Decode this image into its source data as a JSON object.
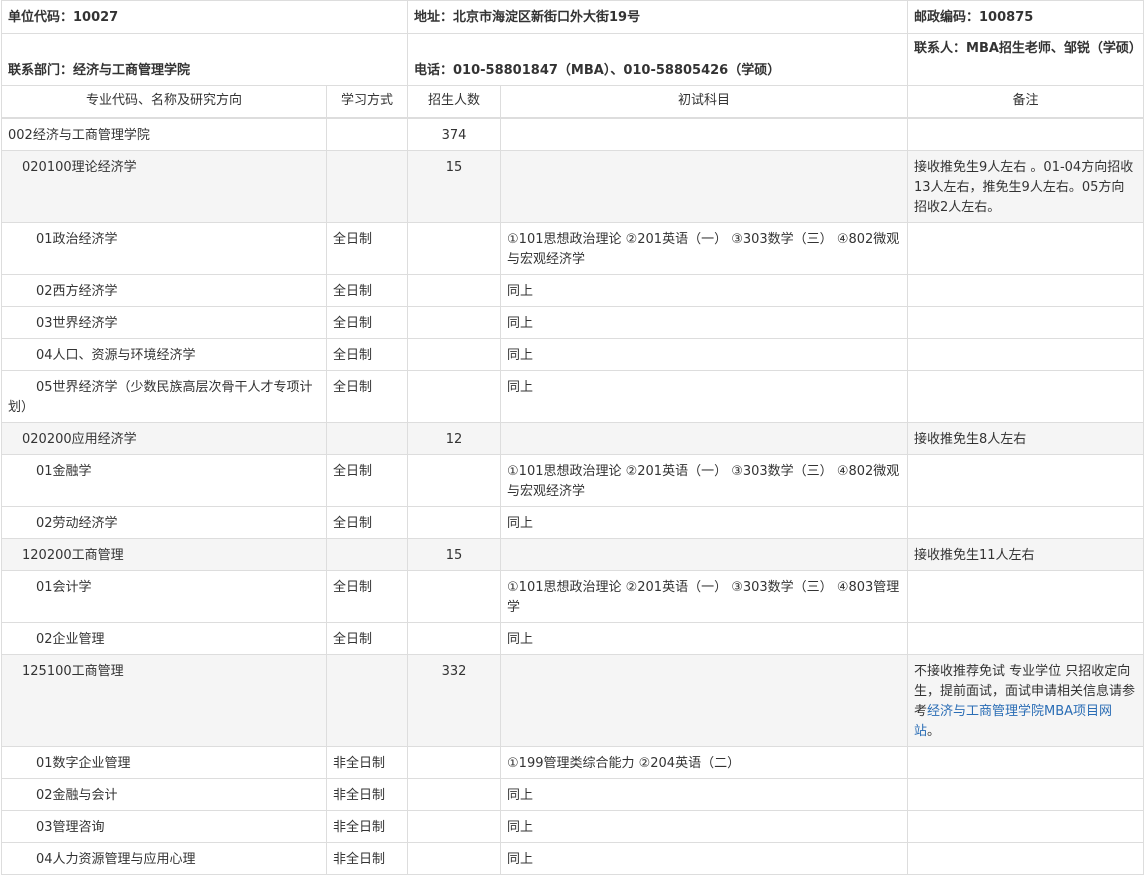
{
  "header": {
    "unit_code": "单位代码：10027",
    "address": "地址：北京市海淀区新街口外大街19号",
    "postcode": "邮政编码：100875",
    "department": "联系部门：经济与工商管理学院",
    "phone": "电话：010-58801847（MBA）、010-58805426（学硕）",
    "contact": "联系人：MBA招生老师、邹锐（学硕）"
  },
  "columns": [
    "专业代码、名称及研究方向",
    "学习方式",
    "招生人数",
    "初试科目",
    "备注"
  ],
  "rows": [
    {
      "name": "002经济与工商管理学院",
      "mode": "",
      "count": "374",
      "subjects": "",
      "note": ""
    },
    {
      "name": "020100理论经济学",
      "mode": "",
      "count": "15",
      "subjects": "",
      "note": "接收推免生9人左右 。01-04方向招收13人左右，推免生9人左右。05方向招收2人左右。"
    },
    {
      "name": "01政治经济学",
      "mode": "全日制",
      "count": "",
      "subjects": "①101思想政治理论 ②201英语（一） ③303数学（三） ④802微观与宏观经济学",
      "note": ""
    },
    {
      "name": "02西方经济学",
      "mode": "全日制",
      "count": "",
      "subjects": "同上",
      "note": ""
    },
    {
      "name": "03世界经济学",
      "mode": "全日制",
      "count": "",
      "subjects": "同上",
      "note": ""
    },
    {
      "name": "04人口、资源与环境经济学",
      "mode": "全日制",
      "count": "",
      "subjects": "同上",
      "note": ""
    },
    {
      "name": "05世界经济学（少数民族高层次骨干人才专项计划）",
      "mode": "全日制",
      "count": "",
      "subjects": "同上",
      "note": ""
    },
    {
      "name": "020200应用经济学",
      "mode": "",
      "count": "12",
      "subjects": "",
      "note": "接收推免生8人左右"
    },
    {
      "name": "01金融学",
      "mode": "全日制",
      "count": "",
      "subjects": "①101思想政治理论 ②201英语（一） ③303数学（三） ④802微观与宏观经济学",
      "note": ""
    },
    {
      "name": "02劳动经济学",
      "mode": "全日制",
      "count": "",
      "subjects": "同上",
      "note": ""
    },
    {
      "name": "120200工商管理",
      "mode": "",
      "count": "15",
      "subjects": "",
      "note": "接收推免生11人左右"
    },
    {
      "name": "01会计学",
      "mode": "全日制",
      "count": "",
      "subjects": "①101思想政治理论 ②201英语（一） ③303数学（三） ④803管理学",
      "note": ""
    },
    {
      "name": "02企业管理",
      "mode": "全日制",
      "count": "",
      "subjects": "同上",
      "note": ""
    },
    {
      "name": "125100工商管理",
      "mode": "",
      "count": "332",
      "subjects": "",
      "note": "不接收推荐免试 专业学位 只招收定向生，提前面试，面试申请相关信息请参考",
      "note_link": "经济与工商管理学院MBA项目网站",
      "note_end": "。"
    },
    {
      "name": "01数字企业管理",
      "mode": "非全日制",
      "count": "",
      "subjects": "①199管理类综合能力 ②204英语（二）",
      "note": ""
    },
    {
      "name": "02金融与会计",
      "mode": "非全日制",
      "count": "",
      "subjects": "同上",
      "note": ""
    },
    {
      "name": "03管理咨询",
      "mode": "非全日制",
      "count": "",
      "subjects": "同上",
      "note": ""
    },
    {
      "name": "04人力资源管理与应用心理",
      "mode": "非全日制",
      "count": "",
      "subjects": "同上",
      "note": ""
    }
  ]
}
